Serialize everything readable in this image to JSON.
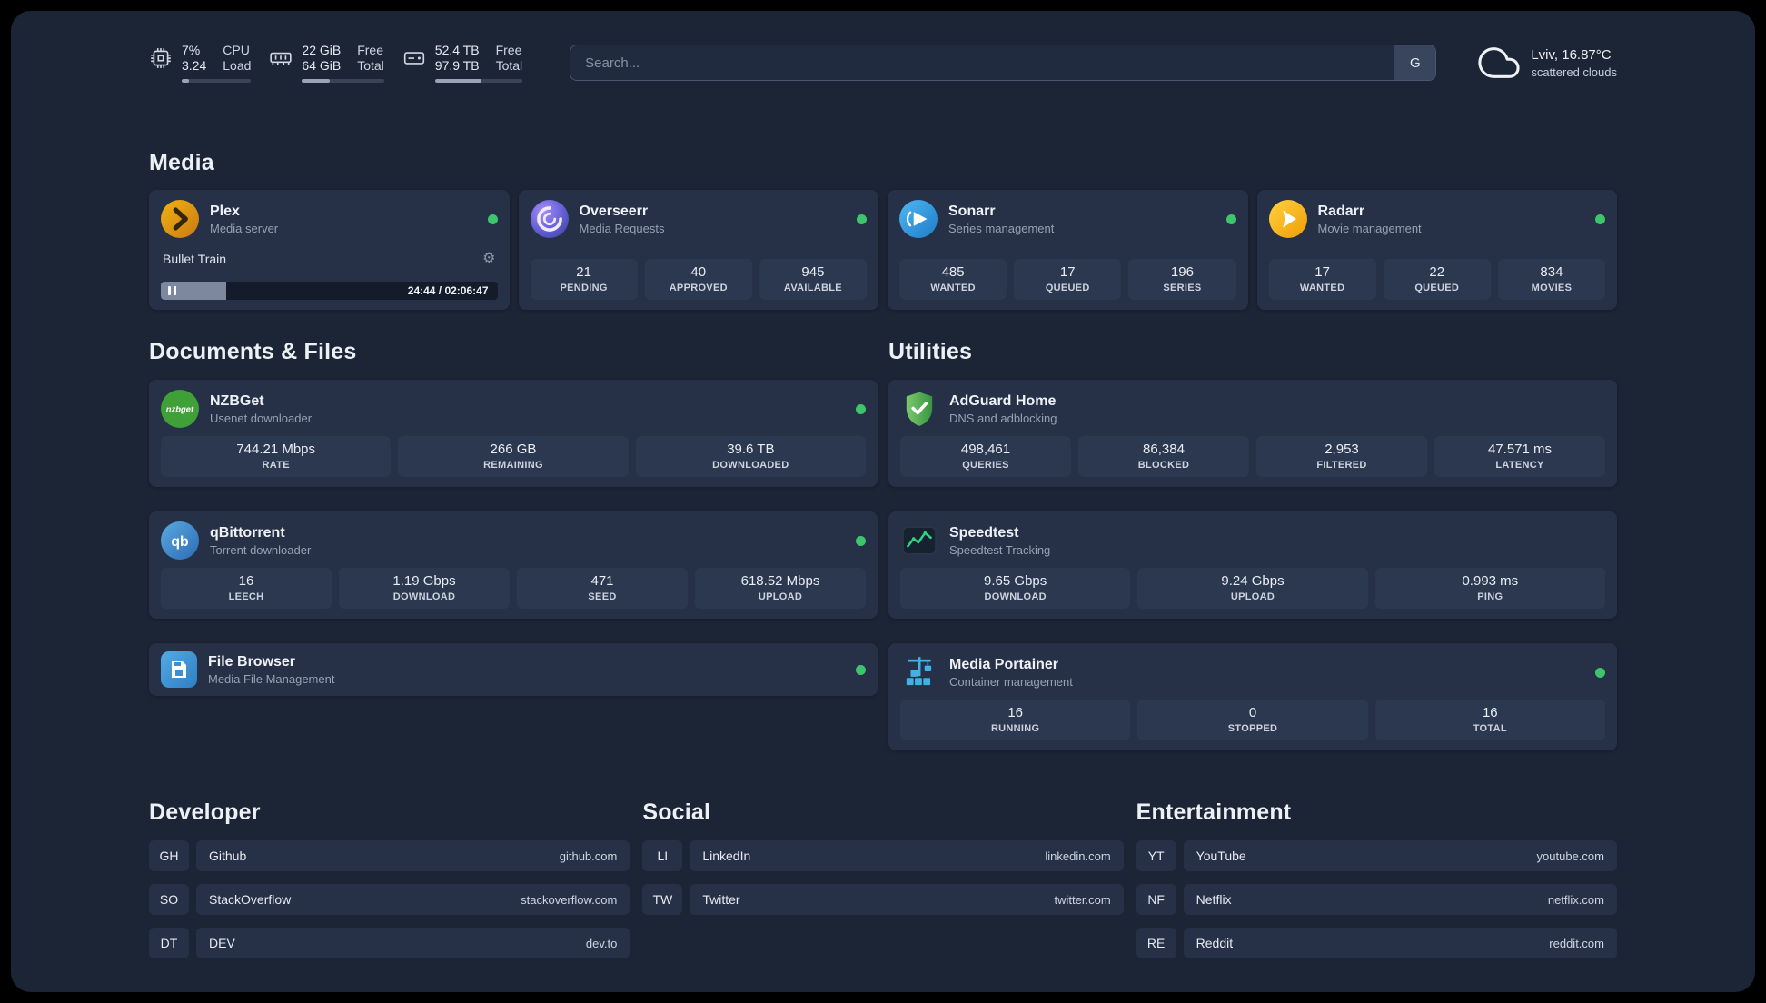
{
  "colors": {
    "background": "#1c2536",
    "card": "#263147",
    "tile": "#2c3850",
    "status_online": "#3ec46d",
    "plex_orange": "#e8a00d",
    "overseerr_purple": "#6a5fd6",
    "sonarr_blue": "#35a5e5",
    "radarr_amber": "#f5b500",
    "nzbget_green": "#3fa037",
    "qbittorrent_blue": "#4f9bd9",
    "filebrowser_blue": "#459fdd",
    "adguard_green": "#4fae58",
    "speedtest_green": "#35d07f",
    "portainer_blue": "#41b1e6"
  },
  "icons": {
    "settings_gear": "⚙"
  },
  "topbar": {
    "cpu": {
      "value_top": "7%",
      "value_bottom": "3.24",
      "label_top": "CPU",
      "label_bottom": "Load",
      "progress_pct": 10
    },
    "ram": {
      "value_top": "22 GiB",
      "value_bottom": "64 GiB",
      "label_top": "Free",
      "label_bottom": "Total",
      "progress_pct": 34
    },
    "disk": {
      "value_top": "52.4 TB",
      "value_bottom": "97.9 TB",
      "label_top": "Free",
      "label_bottom": "Total",
      "progress_pct": 53
    },
    "search": {
      "placeholder": "Search...",
      "engine_label": "G"
    },
    "weather": {
      "location": "Lviv, 16.87°C",
      "condition": "scattered clouds"
    }
  },
  "sections": {
    "media": {
      "title": "Media",
      "plex": {
        "name": "Plex",
        "subtitle": "Media server",
        "now_playing": "Bullet Train",
        "time": "24:44 / 02:06:47",
        "progress_pct": 19.5
      },
      "cards": [
        {
          "name": "Overseerr",
          "subtitle": "Media Requests",
          "stats": [
            {
              "value": "21",
              "label": "PENDING"
            },
            {
              "value": "40",
              "label": "APPROVED"
            },
            {
              "value": "945",
              "label": "AVAILABLE"
            }
          ]
        },
        {
          "name": "Sonarr",
          "subtitle": "Series management",
          "stats": [
            {
              "value": "485",
              "label": "WANTED"
            },
            {
              "value": "17",
              "label": "QUEUED"
            },
            {
              "value": "196",
              "label": "SERIES"
            }
          ]
        },
        {
          "name": "Radarr",
          "subtitle": "Movie management",
          "stats": [
            {
              "value": "17",
              "label": "WANTED"
            },
            {
              "value": "22",
              "label": "QUEUED"
            },
            {
              "value": "834",
              "label": "MOVIES"
            }
          ]
        }
      ]
    },
    "documents": {
      "title": "Documents & Files",
      "cards": [
        {
          "name": "NZBGet",
          "subtitle": "Usenet downloader",
          "stats": [
            {
              "value": "744.21 Mbps",
              "label": "RATE"
            },
            {
              "value": "266 GB",
              "label": "REMAINING"
            },
            {
              "value": "39.6 TB",
              "label": "DOWNLOADED"
            }
          ]
        },
        {
          "name": "qBittorrent",
          "subtitle": "Torrent downloader",
          "stats": [
            {
              "value": "16",
              "label": "LEECH"
            },
            {
              "value": "1.19 Gbps",
              "label": "DOWNLOAD"
            },
            {
              "value": "471",
              "label": "SEED"
            },
            {
              "value": "618.52 Mbps",
              "label": "UPLOAD"
            }
          ]
        },
        {
          "name": "File Browser",
          "subtitle": "Media File Management",
          "stats": []
        }
      ]
    },
    "utilities": {
      "title": "Utilities",
      "cards": [
        {
          "name": "AdGuard Home",
          "subtitle": "DNS and adblocking",
          "stats": [
            {
              "value": "498,461",
              "label": "QUERIES"
            },
            {
              "value": "86,384",
              "label": "BLOCKED"
            },
            {
              "value": "2,953",
              "label": "FILTERED"
            },
            {
              "value": "47.571 ms",
              "label": "LATENCY"
            }
          ]
        },
        {
          "name": "Speedtest",
          "subtitle": "Speedtest Tracking",
          "stats": [
            {
              "value": "9.65 Gbps",
              "label": "DOWNLOAD"
            },
            {
              "value": "9.24 Gbps",
              "label": "UPLOAD"
            },
            {
              "value": "0.993 ms",
              "label": "PING"
            }
          ]
        },
        {
          "name": "Media Portainer",
          "subtitle": "Container management",
          "stats": [
            {
              "value": "16",
              "label": "RUNNING"
            },
            {
              "value": "0",
              "label": "STOPPED"
            },
            {
              "value": "16",
              "label": "TOTAL"
            }
          ]
        }
      ]
    }
  },
  "bookmarks": {
    "groups": [
      {
        "title": "Developer",
        "items": [
          {
            "abbr": "GH",
            "name": "Github",
            "url": "github.com"
          },
          {
            "abbr": "SO",
            "name": "StackOverflow",
            "url": "stackoverflow.com"
          },
          {
            "abbr": "DT",
            "name": "DEV",
            "url": "dev.to"
          }
        ]
      },
      {
        "title": "Social",
        "items": [
          {
            "abbr": "LI",
            "name": "LinkedIn",
            "url": "linkedin.com"
          },
          {
            "abbr": "TW",
            "name": "Twitter",
            "url": "twitter.com"
          }
        ]
      },
      {
        "title": "Entertainment",
        "items": [
          {
            "abbr": "YT",
            "name": "YouTube",
            "url": "youtube.com"
          },
          {
            "abbr": "NF",
            "name": "Netflix",
            "url": "netflix.com"
          },
          {
            "abbr": "RE",
            "name": "Reddit",
            "url": "reddit.com"
          }
        ]
      }
    ]
  }
}
